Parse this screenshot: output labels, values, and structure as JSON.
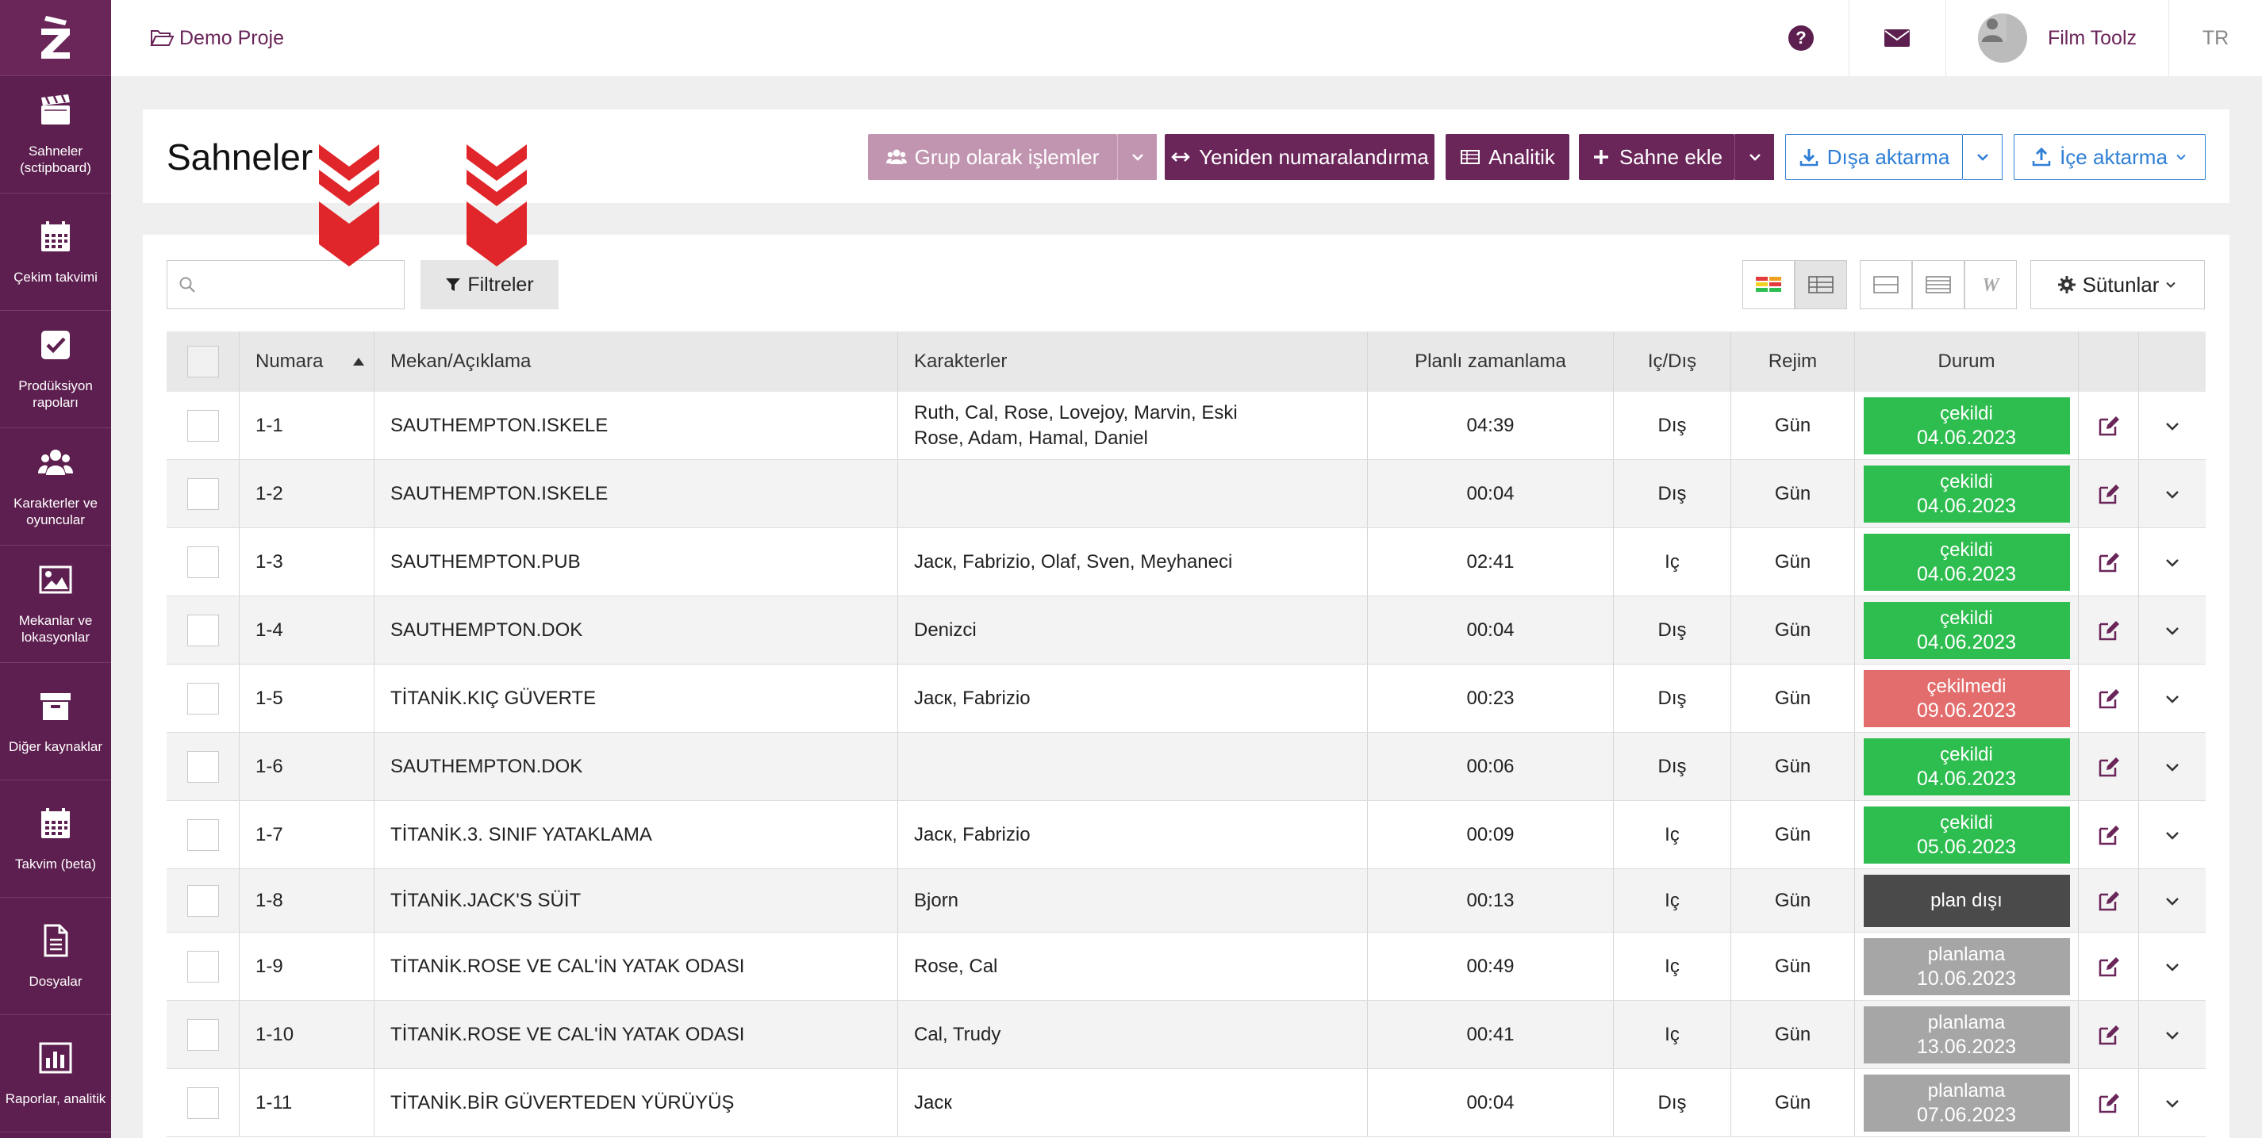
{
  "colors": {
    "brand": "#5d1f4f",
    "brand_accent": "#6a2559",
    "status_done": "#2ebd4f",
    "status_not_done": "#e36c6c",
    "status_unplanned": "#4a4a4a",
    "status_planning": "#a6a6a6",
    "button_blue": "#2f7fd6",
    "button_muted": "#c195b0",
    "arrow_red": "#e0262a"
  },
  "sidebar": {
    "items": [
      {
        "label": "Sahneler (sctipboard)",
        "icon": "clapperboard-icon"
      },
      {
        "label": "Çekim takvimi",
        "icon": "calendar-icon"
      },
      {
        "label": "Prodüksiyon rapoları",
        "icon": "checkbox-icon"
      },
      {
        "label": "Karakterler ve oyuncular",
        "icon": "users-icon"
      },
      {
        "label": "Mekanlar ve lokasyonlar",
        "icon": "image-icon"
      },
      {
        "label": "Diğer kaynaklar",
        "icon": "archive-icon"
      },
      {
        "label": "Takvim (beta)",
        "icon": "calendar-icon"
      },
      {
        "label": "Dosyalar",
        "icon": "file-icon"
      },
      {
        "label": "Raporlar, analitik",
        "icon": "bar-chart-icon"
      }
    ]
  },
  "topbar": {
    "project": "Demo Proje",
    "user_name": "Film Toolz",
    "language": "TR"
  },
  "header": {
    "title": "Sahneler",
    "buttons": {
      "group": "Grup olarak işlemler",
      "renumber": "Yeniden numaralandırma",
      "analytics": "Analitik",
      "add_scene": "Sahne ekle",
      "export": "Dışa aktarma",
      "import": "İçe aktarma"
    }
  },
  "toolbar": {
    "search_placeholder": "",
    "filters": "Filtreler",
    "columns": "Sütunlar"
  },
  "table": {
    "headers": {
      "number": "Numara",
      "location": "Mekan/Açıklama",
      "characters": "Karakterler",
      "planned": "Planlı zamanlama",
      "inout": "Iç/Dış",
      "regime": "Rejim",
      "status": "Durum"
    },
    "rows": [
      {
        "number": "1-1",
        "location": "SAUTHEMPTON.ISKELE",
        "characters": "Ruth, Cal, Rose, Lovejoy, Marvin, Eski Rose, Adam, Hamal, Daniel",
        "planned": "04:39",
        "inout": "Dış",
        "regime": "Gün",
        "status": "çekildi",
        "date": "04.06.2023",
        "kind": "done"
      },
      {
        "number": "1-2",
        "location": "SAUTHEMPTON.ISKELE",
        "characters": "",
        "planned": "00:04",
        "inout": "Dış",
        "regime": "Gün",
        "status": "çekildi",
        "date": "04.06.2023",
        "kind": "done"
      },
      {
        "number": "1-3",
        "location": "SAUTHEMPTON.PUB",
        "characters": "Jacк, Fabrizio, Olaf, Sven, Meyhaneci",
        "planned": "02:41",
        "inout": "Iç",
        "regime": "Gün",
        "status": "çekildi",
        "date": "04.06.2023",
        "kind": "done"
      },
      {
        "number": "1-4",
        "location": "SAUTHEMPTON.DOK",
        "characters": "Denizci",
        "planned": "00:04",
        "inout": "Dış",
        "regime": "Gün",
        "status": "çekildi",
        "date": "04.06.2023",
        "kind": "done"
      },
      {
        "number": "1-5",
        "location": "TİTANİK.KIÇ GÜVERTE",
        "characters": "Jacк, Fabrizio",
        "planned": "00:23",
        "inout": "Dış",
        "regime": "Gün",
        "status": "çekilmedi",
        "date": "09.06.2023",
        "kind": "not_done"
      },
      {
        "number": "1-6",
        "location": "SAUTHEMPTON.DOK",
        "characters": "",
        "planned": "00:06",
        "inout": "Dış",
        "regime": "Gün",
        "status": "çekildi",
        "date": "04.06.2023",
        "kind": "done"
      },
      {
        "number": "1-7",
        "location": "TİTANİK.3. SINIF YATAKLAMA",
        "characters": "Jacк, Fabrizio",
        "planned": "00:09",
        "inout": "Iç",
        "regime": "Gün",
        "status": "çekildi",
        "date": "05.06.2023",
        "kind": "done"
      },
      {
        "number": "1-8",
        "location": "TİTANİK.JACK'S SÜİT",
        "characters": "Bjorn",
        "planned": "00:13",
        "inout": "Iç",
        "regime": "Gün",
        "status": "plan dışı",
        "date": "",
        "kind": "unplanned"
      },
      {
        "number": "1-9",
        "location": "TİTANİK.ROSE VE CAL'İN YATAK ODASI",
        "characters": "Rose, Cal",
        "planned": "00:49",
        "inout": "Iç",
        "regime": "Gün",
        "status": "planlama",
        "date": "10.06.2023",
        "kind": "planning"
      },
      {
        "number": "1-10",
        "location": "TİTANİK.ROSE VE CAL'İN YATAK ODASI",
        "characters": "Cal, Trudy",
        "planned": "00:41",
        "inout": "Iç",
        "regime": "Gün",
        "status": "planlama",
        "date": "13.06.2023",
        "kind": "planning"
      },
      {
        "number": "1-11",
        "location": "TİTANİK.BİR GÜVERTEDEN YÜRÜYÜŞ",
        "characters": "Jacк",
        "planned": "00:04",
        "inout": "Dış",
        "regime": "Gün",
        "status": "planlama",
        "date": "07.06.2023",
        "kind": "planning"
      }
    ]
  }
}
